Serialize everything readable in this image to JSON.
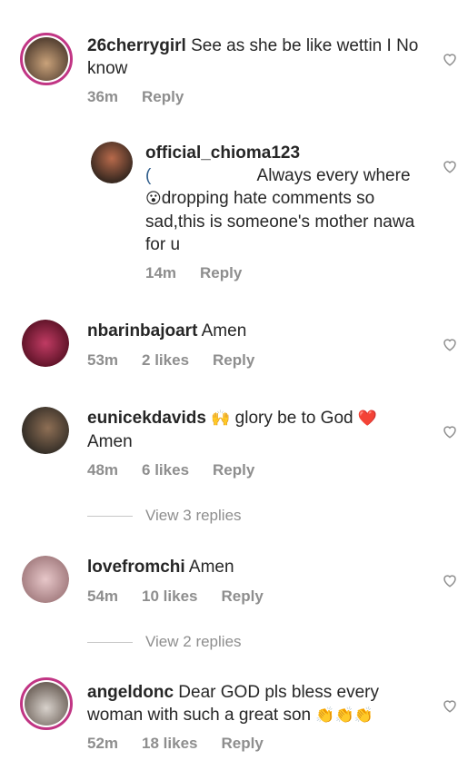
{
  "comments": [
    {
      "user": "26cherrygirl",
      "text": " See as she be like wettin I No know",
      "time": "36m",
      "likes": "",
      "reply": "Reply"
    },
    {
      "user": "official_chioma123",
      "mention": "(",
      "text": " Always every where",
      "emoji": "😮",
      "text2": "dropping hate comments so sad,this is someone's mother nawa for u",
      "time": "14m",
      "likes": "",
      "reply": "Reply"
    },
    {
      "user": "nbarinbajoart",
      "text": " Amen",
      "time": "53m",
      "likes": "2 likes",
      "reply": "Reply"
    },
    {
      "user": "eunicekdavids",
      "emoji": "🙌",
      "text": " glory be to God ",
      "heart": "❤️",
      "text2": "Amen",
      "time": "48m",
      "likes": "6 likes",
      "reply": "Reply"
    },
    {
      "user": "lovefromchi",
      "text": " Amen",
      "time": "54m",
      "likes": "10 likes",
      "reply": "Reply"
    },
    {
      "user": "angeldonc",
      "text": " Dear GOD pls bless every woman with such a great son ",
      "emoji": "👏👏👏",
      "time": "52m",
      "likes": "18 likes",
      "reply": "Reply"
    }
  ],
  "view_replies": [
    "View 3 replies",
    "View 2 replies"
  ],
  "colors": {
    "story_ring": "#c13584",
    "muted": "#8e8e8e",
    "text": "#262626"
  }
}
